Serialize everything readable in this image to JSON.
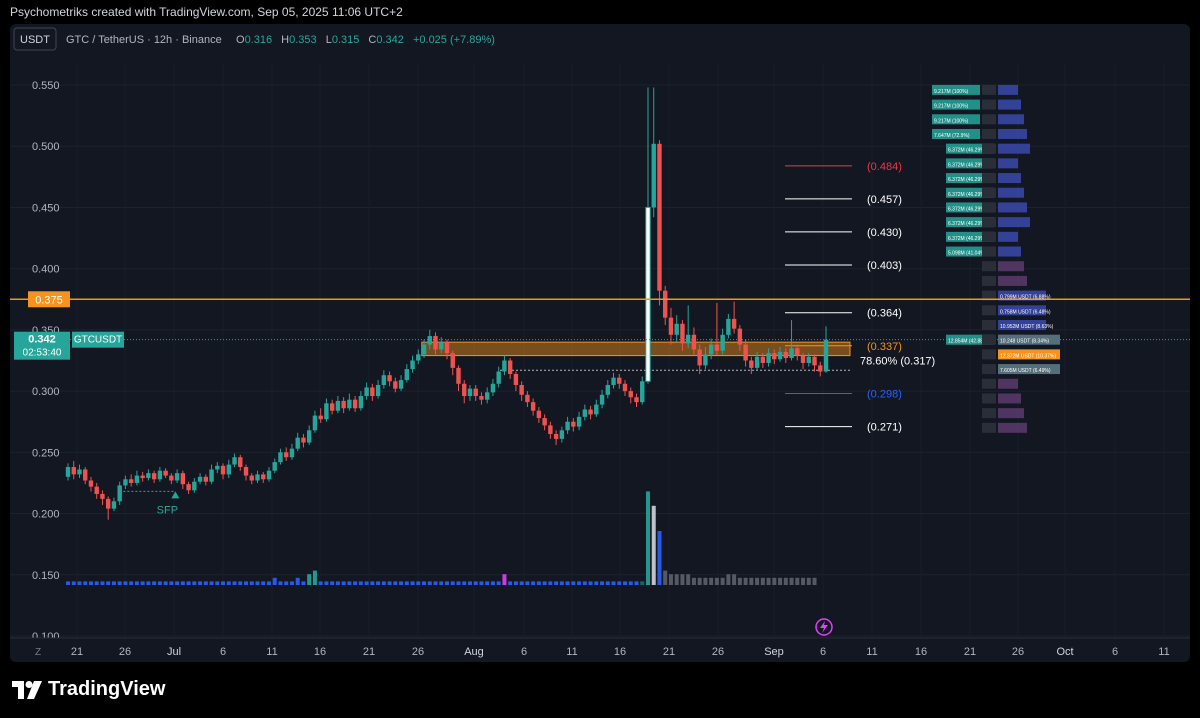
{
  "header": {
    "credit": "Psychometriks created with TradingView.com, Sep 05, 2025 11:06 UTC+2"
  },
  "symbol_bar": {
    "currency_button": "USDT",
    "title": "GTC / TetherUS · 12h · Binance",
    "o_label": "O",
    "o_value": "0.316",
    "h_label": "H",
    "h_value": "0.353",
    "l_label": "L",
    "l_value": "0.315",
    "c_label": "C",
    "c_value": "0.342",
    "change": "+0.025 (+7.89%)"
  },
  "footer": {
    "brand": "TradingView"
  },
  "chart_data": {
    "type": "candlestick",
    "symbol": "GTCUSDT",
    "ylim": [
      0.1,
      0.56
    ],
    "y_ticks": [
      "0.550",
      "0.500",
      "0.450",
      "0.400",
      "0.350",
      "0.300",
      "0.250",
      "0.200",
      "0.150",
      "0.100"
    ],
    "x_ticks": [
      "21",
      "26",
      "Jul",
      "6",
      "11",
      "16",
      "21",
      "26",
      "Aug",
      "6",
      "11",
      "16",
      "21",
      "26",
      "Sep",
      "6",
      "11",
      "16",
      "21",
      "26",
      "Oct",
      "6",
      "11"
    ],
    "timezone_button": "Z",
    "price_labels": [
      {
        "text": "0.375",
        "value": 0.375,
        "color": "#f7931a"
      }
    ],
    "last_price": {
      "value": "0.342",
      "countdown": "02:53:40",
      "symbol_tag": "GTCUSDT",
      "price": 0.342
    },
    "horizontal_line": {
      "value": 0.375,
      "color": "#f7931a"
    },
    "fib_levels": [
      {
        "label": "(0.484)",
        "value": 0.484,
        "color": "#f23645"
      },
      {
        "label": "(0.457)",
        "value": 0.457,
        "color": "#ffffff"
      },
      {
        "label": "(0.430)",
        "value": 0.43,
        "color": "#ffffff"
      },
      {
        "label": "(0.403)",
        "value": 0.403,
        "color": "#ffffff"
      },
      {
        "label": "(0.364)",
        "value": 0.364,
        "color": "#ffffff"
      },
      {
        "label": "(0.337)",
        "value": 0.337,
        "color": "#f7931a"
      },
      {
        "label": "78.60% (0.317)",
        "value": 0.317,
        "color": "#ffffff"
      },
      {
        "label": "(0.298)",
        "value": 0.298,
        "color": "#2962ff"
      },
      {
        "label": "(0.271)",
        "value": 0.271,
        "color": "#ffffff"
      }
    ],
    "zone": {
      "top": 0.34,
      "bottom": 0.329,
      "color": "#f7931a",
      "start": "Jul 18",
      "end": "Sep 5"
    },
    "annotations": [
      {
        "text": "SFP",
        "color": "#26a69a",
        "date": "Jul 1",
        "price": 0.214
      }
    ],
    "candles_12h": [
      [
        0.23,
        0.238,
        0.241,
        0.227
      ],
      [
        0.238,
        0.232,
        0.243,
        0.228
      ],
      [
        0.232,
        0.236,
        0.24,
        0.229
      ],
      [
        0.236,
        0.227,
        0.238,
        0.224
      ],
      [
        0.227,
        0.222,
        0.23,
        0.218
      ],
      [
        0.222,
        0.216,
        0.225,
        0.212
      ],
      [
        0.216,
        0.212,
        0.219,
        0.207
      ],
      [
        0.212,
        0.204,
        0.214,
        0.195
      ],
      [
        0.204,
        0.21,
        0.213,
        0.202
      ],
      [
        0.21,
        0.223,
        0.226,
        0.207
      ],
      [
        0.223,
        0.228,
        0.231,
        0.22
      ],
      [
        0.228,
        0.225,
        0.232,
        0.222
      ],
      [
        0.225,
        0.231,
        0.235,
        0.223
      ],
      [
        0.231,
        0.229,
        0.234,
        0.226
      ],
      [
        0.229,
        0.233,
        0.236,
        0.227
      ],
      [
        0.233,
        0.228,
        0.235,
        0.225
      ],
      [
        0.228,
        0.235,
        0.238,
        0.226
      ],
      [
        0.235,
        0.231,
        0.237,
        0.229
      ],
      [
        0.231,
        0.227,
        0.233,
        0.224
      ],
      [
        0.227,
        0.233,
        0.236,
        0.225
      ],
      [
        0.233,
        0.224,
        0.235,
        0.22
      ],
      [
        0.224,
        0.219,
        0.226,
        0.216
      ],
      [
        0.219,
        0.226,
        0.229,
        0.217
      ],
      [
        0.226,
        0.23,
        0.233,
        0.224
      ],
      [
        0.23,
        0.226,
        0.232,
        0.223
      ],
      [
        0.226,
        0.236,
        0.24,
        0.224
      ],
      [
        0.236,
        0.239,
        0.242,
        0.233
      ],
      [
        0.239,
        0.232,
        0.241,
        0.228
      ],
      [
        0.232,
        0.24,
        0.244,
        0.229
      ],
      [
        0.24,
        0.246,
        0.249,
        0.238
      ],
      [
        0.246,
        0.238,
        0.248,
        0.235
      ],
      [
        0.238,
        0.231,
        0.24,
        0.227
      ],
      [
        0.231,
        0.227,
        0.233,
        0.224
      ],
      [
        0.227,
        0.232,
        0.235,
        0.225
      ],
      [
        0.232,
        0.228,
        0.234,
        0.225
      ],
      [
        0.228,
        0.235,
        0.238,
        0.226
      ],
      [
        0.235,
        0.242,
        0.245,
        0.233
      ],
      [
        0.242,
        0.25,
        0.253,
        0.24
      ],
      [
        0.25,
        0.246,
        0.254,
        0.243
      ],
      [
        0.246,
        0.253,
        0.257,
        0.244
      ],
      [
        0.253,
        0.262,
        0.266,
        0.251
      ],
      [
        0.262,
        0.258,
        0.265,
        0.254
      ],
      [
        0.258,
        0.268,
        0.272,
        0.256
      ],
      [
        0.268,
        0.28,
        0.284,
        0.266
      ],
      [
        0.28,
        0.277,
        0.286,
        0.274
      ],
      [
        0.277,
        0.29,
        0.294,
        0.275
      ],
      [
        0.29,
        0.284,
        0.293,
        0.281
      ],
      [
        0.284,
        0.292,
        0.296,
        0.282
      ],
      [
        0.292,
        0.286,
        0.295,
        0.282
      ],
      [
        0.286,
        0.293,
        0.298,
        0.284
      ],
      [
        0.293,
        0.286,
        0.296,
        0.283
      ],
      [
        0.286,
        0.296,
        0.3,
        0.284
      ],
      [
        0.296,
        0.303,
        0.307,
        0.293
      ],
      [
        0.303,
        0.296,
        0.306,
        0.292
      ],
      [
        0.296,
        0.305,
        0.309,
        0.294
      ],
      [
        0.305,
        0.313,
        0.317,
        0.302
      ],
      [
        0.313,
        0.308,
        0.316,
        0.304
      ],
      [
        0.308,
        0.302,
        0.311,
        0.299
      ],
      [
        0.302,
        0.309,
        0.313,
        0.3
      ],
      [
        0.309,
        0.318,
        0.322,
        0.307
      ],
      [
        0.318,
        0.325,
        0.329,
        0.315
      ],
      [
        0.325,
        0.33,
        0.334,
        0.322
      ],
      [
        0.33,
        0.338,
        0.342,
        0.327
      ],
      [
        0.338,
        0.345,
        0.35,
        0.334
      ],
      [
        0.345,
        0.334,
        0.348,
        0.33
      ],
      [
        0.334,
        0.34,
        0.344,
        0.331
      ],
      [
        0.34,
        0.331,
        0.342,
        0.326
      ],
      [
        0.331,
        0.319,
        0.333,
        0.313
      ],
      [
        0.319,
        0.306,
        0.321,
        0.3
      ],
      [
        0.306,
        0.296,
        0.309,
        0.29
      ],
      [
        0.296,
        0.302,
        0.305,
        0.292
      ],
      [
        0.302,
        0.296,
        0.305,
        0.292
      ],
      [
        0.296,
        0.293,
        0.299,
        0.289
      ],
      [
        0.293,
        0.299,
        0.303,
        0.29
      ],
      [
        0.299,
        0.306,
        0.31,
        0.296
      ],
      [
        0.306,
        0.316,
        0.32,
        0.303
      ],
      [
        0.316,
        0.325,
        0.329,
        0.313
      ],
      [
        0.325,
        0.314,
        0.327,
        0.31
      ],
      [
        0.314,
        0.305,
        0.316,
        0.3
      ],
      [
        0.305,
        0.297,
        0.308,
        0.292
      ],
      [
        0.297,
        0.291,
        0.3,
        0.287
      ],
      [
        0.291,
        0.284,
        0.294,
        0.28
      ],
      [
        0.284,
        0.278,
        0.287,
        0.274
      ],
      [
        0.278,
        0.272,
        0.281,
        0.268
      ],
      [
        0.272,
        0.265,
        0.275,
        0.261
      ],
      [
        0.265,
        0.261,
        0.268,
        0.256
      ],
      [
        0.261,
        0.268,
        0.271,
        0.258
      ],
      [
        0.268,
        0.275,
        0.279,
        0.265
      ],
      [
        0.275,
        0.271,
        0.278,
        0.267
      ],
      [
        0.271,
        0.279,
        0.283,
        0.268
      ],
      [
        0.279,
        0.285,
        0.289,
        0.276
      ],
      [
        0.285,
        0.281,
        0.288,
        0.277
      ],
      [
        0.281,
        0.289,
        0.293,
        0.279
      ],
      [
        0.289,
        0.297,
        0.301,
        0.286
      ],
      [
        0.297,
        0.305,
        0.309,
        0.294
      ],
      [
        0.305,
        0.311,
        0.315,
        0.302
      ],
      [
        0.311,
        0.306,
        0.314,
        0.302
      ],
      [
        0.306,
        0.3,
        0.309,
        0.296
      ],
      [
        0.3,
        0.295,
        0.303,
        0.29
      ],
      [
        0.295,
        0.291,
        0.298,
        0.287
      ],
      [
        0.291,
        0.308,
        0.312,
        0.289
      ],
      [
        0.308,
        0.45,
        0.548,
        0.306
      ],
      [
        0.45,
        0.502,
        0.548,
        0.442
      ],
      [
        0.502,
        0.382,
        0.505,
        0.37
      ],
      [
        0.382,
        0.36,
        0.386,
        0.354
      ],
      [
        0.36,
        0.346,
        0.368,
        0.338
      ],
      [
        0.346,
        0.355,
        0.362,
        0.34
      ],
      [
        0.355,
        0.339,
        0.358,
        0.333
      ],
      [
        0.339,
        0.346,
        0.37,
        0.335
      ],
      [
        0.346,
        0.334,
        0.352,
        0.329
      ],
      [
        0.334,
        0.321,
        0.338,
        0.314
      ],
      [
        0.321,
        0.33,
        0.336,
        0.318
      ],
      [
        0.33,
        0.338,
        0.343,
        0.326
      ],
      [
        0.338,
        0.333,
        0.372,
        0.329
      ],
      [
        0.333,
        0.346,
        0.351,
        0.33
      ],
      [
        0.346,
        0.359,
        0.363,
        0.343
      ],
      [
        0.359,
        0.351,
        0.373,
        0.347
      ],
      [
        0.351,
        0.338,
        0.354,
        0.333
      ],
      [
        0.338,
        0.325,
        0.342,
        0.32
      ],
      [
        0.325,
        0.319,
        0.328,
        0.314
      ],
      [
        0.319,
        0.328,
        0.332,
        0.317
      ],
      [
        0.328,
        0.323,
        0.331,
        0.319
      ],
      [
        0.323,
        0.331,
        0.335,
        0.32
      ],
      [
        0.331,
        0.326,
        0.334,
        0.322
      ],
      [
        0.326,
        0.332,
        0.336,
        0.324
      ],
      [
        0.332,
        0.327,
        0.335,
        0.323
      ],
      [
        0.327,
        0.335,
        0.358,
        0.325
      ],
      [
        0.335,
        0.329,
        0.338,
        0.325
      ],
      [
        0.329,
        0.323,
        0.331,
        0.318
      ],
      [
        0.323,
        0.328,
        0.331,
        0.32
      ],
      [
        0.328,
        0.321,
        0.33,
        0.316
      ],
      [
        0.321,
        0.316,
        0.324,
        0.312
      ],
      [
        0.316,
        0.342,
        0.353,
        0.315
      ]
    ],
    "volume_rel": [
      1,
      1,
      1,
      1,
      1,
      1,
      1,
      1,
      1,
      1,
      1,
      1,
      1,
      1,
      1,
      1,
      1,
      1,
      1,
      1,
      1,
      1,
      1,
      1,
      1,
      1,
      1,
      1,
      1,
      1,
      1,
      1,
      1,
      1,
      1,
      1,
      2,
      1,
      1,
      1,
      2,
      1,
      3,
      4,
      1,
      1,
      1,
      1,
      1,
      1,
      1,
      1,
      1,
      1,
      1,
      1,
      1,
      1,
      1,
      1,
      1,
      1,
      1,
      1,
      1,
      1,
      1,
      1,
      1,
      1,
      1,
      1,
      1,
      1,
      1,
      1,
      3,
      1,
      1,
      1,
      1,
      1,
      1,
      1,
      1,
      1,
      1,
      1,
      1,
      1,
      1,
      1,
      1,
      1,
      1,
      1,
      1,
      1,
      1,
      1,
      1,
      26,
      22,
      15,
      4,
      3,
      3,
      3,
      3,
      2,
      2,
      2,
      2,
      2,
      2,
      3,
      3,
      2,
      2,
      2,
      2,
      2,
      2,
      2,
      2,
      2,
      2,
      2,
      2,
      2,
      2
    ],
    "order_book": [
      {
        "price": 0.546,
        "label": "9.217M (100%)",
        "side": "ask"
      },
      {
        "price": 0.534,
        "label": "9.217M (100%)",
        "side": "ask"
      },
      {
        "price": 0.522,
        "label": "9.217M (100%)",
        "side": "ask"
      },
      {
        "price": 0.51,
        "label": "7.647M (72.9%)",
        "side": "ask"
      },
      {
        "price": 0.498,
        "label": "6.372M (46.29%)",
        "side": "ask"
      },
      {
        "price": 0.486,
        "label": "6.372M (46.29%)",
        "side": "ask"
      },
      {
        "price": 0.474,
        "label": "6.372M (46.29%)",
        "side": "ask"
      },
      {
        "price": 0.462,
        "label": "6.372M (46.29%)",
        "side": "ask"
      },
      {
        "price": 0.45,
        "label": "6.372M (46.29%)",
        "side": "ask"
      },
      {
        "price": 0.438,
        "label": "6.372M (46.29%)",
        "side": "ask"
      },
      {
        "price": 0.426,
        "label": "6.372M (46.29%)",
        "side": "ask"
      },
      {
        "price": 0.414,
        "label": "5.098M (41.04%)",
        "side": "ask"
      },
      {
        "price": 0.402,
        "label": "",
        "side": "ask"
      },
      {
        "price": 0.39,
        "label": "",
        "side": "ask"
      },
      {
        "price": 0.378,
        "label": "0.799M USDT (6.88%)",
        "side": "bid"
      },
      {
        "price": 0.366,
        "label": "0.758M USDT (6.48%)",
        "side": "bid"
      },
      {
        "price": 0.354,
        "label": "10.952M USDT (8.63%)",
        "side": "bid"
      },
      {
        "price": 0.342,
        "label": "12.854M (42.88%)",
        "side": "ask",
        "mid": "10.248 USDT (8.34%)"
      },
      {
        "price": 0.33,
        "label": "",
        "side": "ask",
        "mid": "12.372M USDT (10.37%)"
      },
      {
        "price": 0.318,
        "label": "",
        "side": "ask",
        "mid": "7.605M USDT (6.49%)"
      },
      {
        "price": 0.306,
        "label": "",
        "side": "ask"
      },
      {
        "price": 0.294,
        "label": "",
        "side": "ask"
      },
      {
        "price": 0.282,
        "label": "",
        "side": "ask"
      },
      {
        "price": 0.27,
        "label": "",
        "side": "ask"
      }
    ]
  }
}
